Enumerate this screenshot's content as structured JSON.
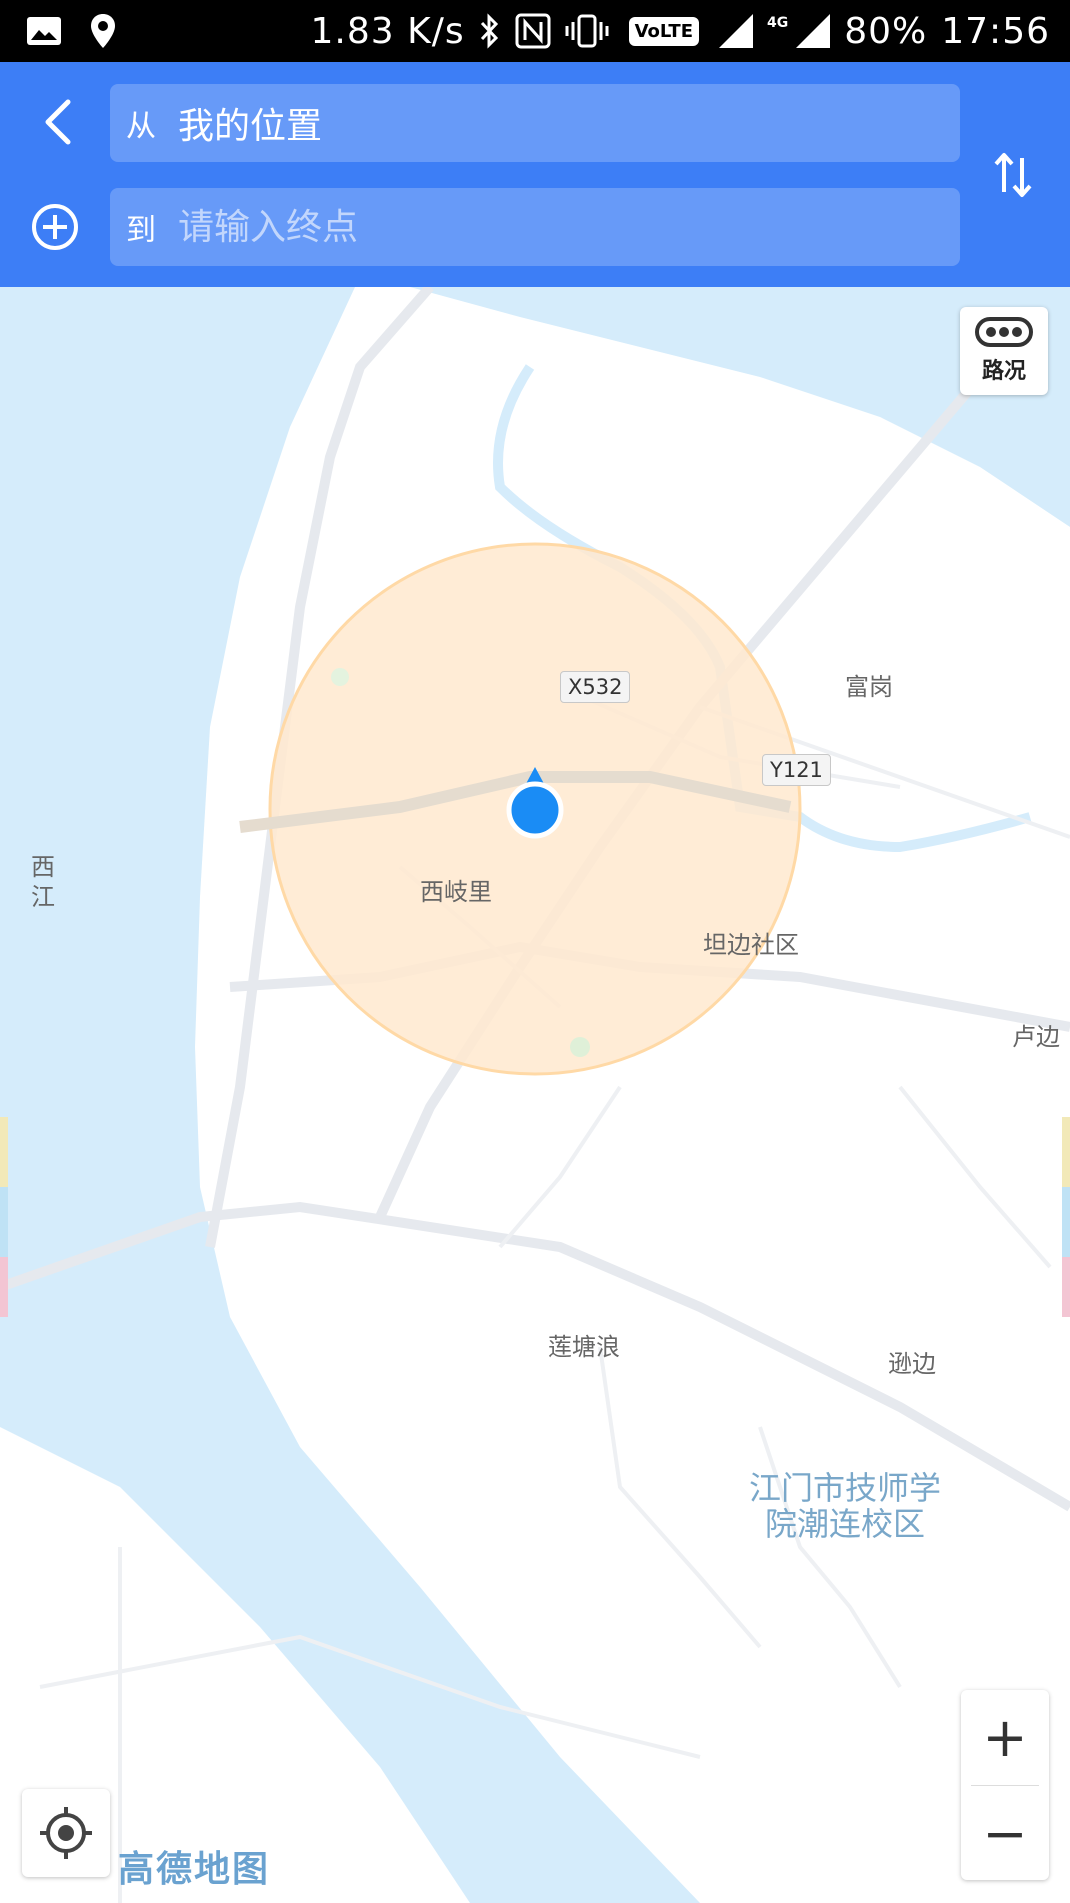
{
  "status_bar": {
    "speed": "1.83 K/s",
    "network_badge": "VoLTE",
    "network_type": "4G",
    "battery": "80%",
    "time": "17:56"
  },
  "route": {
    "from_prefix": "从",
    "from_value": "我的位置",
    "to_prefix": "到",
    "to_placeholder": "请输入终点"
  },
  "map": {
    "traffic_label": "路况",
    "labels": {
      "xijiang": "西\n江",
      "fugang": "富岗",
      "xiqili": "西岐里",
      "tanbian": "坦边社区",
      "lubian": "卢边",
      "liantanglang": "莲塘浪",
      "xunbian": "逊边",
      "school": "江门市技师学\n院潮连校区"
    },
    "road_tags": {
      "x532": "X532",
      "y121": "Y121"
    },
    "zoom_in": "+",
    "zoom_out": "−",
    "logo": "高德地图"
  },
  "colors": {
    "header_blue": "#3d7ef6",
    "water": "#d5ecfb",
    "land": "#ffffff",
    "accuracy_circle": "#ffe9cf",
    "location_dot": "#1a8cf5"
  }
}
